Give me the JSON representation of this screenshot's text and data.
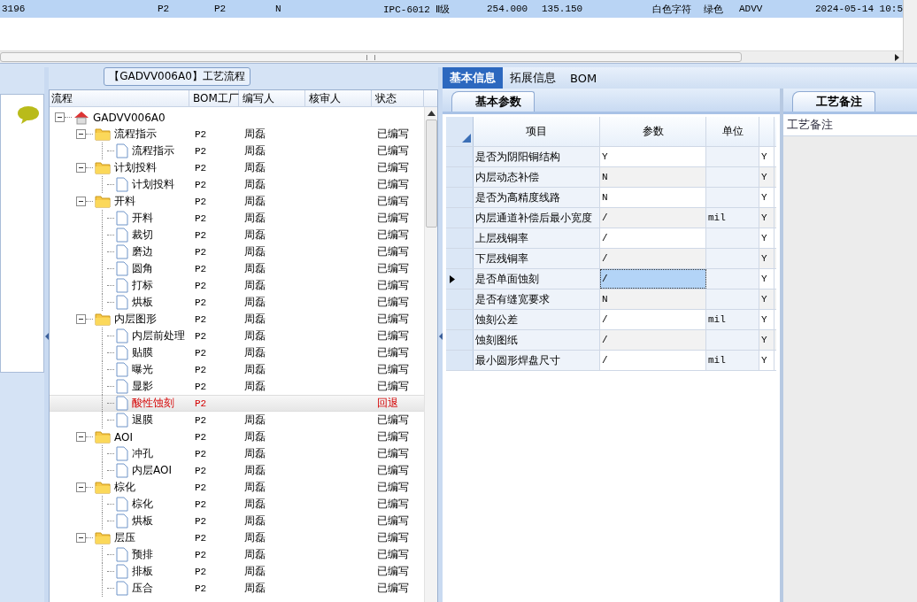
{
  "top_grid": {
    "rows": [
      {
        "selected": true,
        "cells": [
          "3196",
          "P2",
          "P2",
          "N",
          "IPC-6012 Ⅱ级",
          "254.000",
          "135.150",
          "白色字符",
          "绿色",
          "ADVV",
          "2024-05-14 10:5"
        ]
      }
    ]
  },
  "tree": {
    "title": "【GADVV006A0】工艺流程",
    "columns": [
      "流程",
      "BOM工厂",
      "编写人",
      "核审人",
      "状态"
    ],
    "nodes": [
      {
        "label": "GADVV006A0",
        "kind": "root",
        "expanded": true,
        "selected": false,
        "returned": false,
        "children": [
          {
            "label": "流程指示",
            "kind": "folder",
            "factory": "P2",
            "author": "周磊",
            "status": "已编写",
            "expanded": true,
            "selected": false,
            "returned": false,
            "children": [
              {
                "label": "流程指示",
                "kind": "doc",
                "factory": "P2",
                "author": "周磊",
                "status": "已编写",
                "selected": false,
                "returned": false
              }
            ]
          },
          {
            "label": "计划投料",
            "kind": "folder",
            "factory": "P2",
            "author": "周磊",
            "status": "已编写",
            "expanded": true,
            "selected": false,
            "returned": false,
            "children": [
              {
                "label": "计划投料",
                "kind": "doc",
                "factory": "P2",
                "author": "周磊",
                "status": "已编写",
                "selected": false,
                "returned": false
              }
            ]
          },
          {
            "label": "开料",
            "kind": "folder",
            "factory": "P2",
            "author": "周磊",
            "status": "已编写",
            "expanded": true,
            "selected": false,
            "returned": false,
            "children": [
              {
                "label": "开料",
                "kind": "doc",
                "factory": "P2",
                "author": "周磊",
                "status": "已编写",
                "selected": false,
                "returned": false
              },
              {
                "label": "裁切",
                "kind": "doc",
                "factory": "P2",
                "author": "周磊",
                "status": "已编写",
                "selected": false,
                "returned": false
              },
              {
                "label": "磨边",
                "kind": "doc",
                "factory": "P2",
                "author": "周磊",
                "status": "已编写",
                "selected": false,
                "returned": false
              },
              {
                "label": "圆角",
                "kind": "doc",
                "factory": "P2",
                "author": "周磊",
                "status": "已编写",
                "selected": false,
                "returned": false
              },
              {
                "label": "打标",
                "kind": "doc",
                "factory": "P2",
                "author": "周磊",
                "status": "已编写",
                "selected": false,
                "returned": false
              },
              {
                "label": "烘板",
                "kind": "doc",
                "factory": "P2",
                "author": "周磊",
                "status": "已编写",
                "selected": false,
                "returned": false
              }
            ]
          },
          {
            "label": "内层图形",
            "kind": "folder",
            "factory": "P2",
            "author": "周磊",
            "status": "已编写",
            "expanded": true,
            "selected": false,
            "returned": false,
            "children": [
              {
                "label": "内层前处理",
                "kind": "doc",
                "factory": "P2",
                "author": "周磊",
                "status": "已编写",
                "selected": false,
                "returned": false
              },
              {
                "label": "贴膜",
                "kind": "doc",
                "factory": "P2",
                "author": "周磊",
                "status": "已编写",
                "selected": false,
                "returned": false
              },
              {
                "label": "曝光",
                "kind": "doc",
                "factory": "P2",
                "author": "周磊",
                "status": "已编写",
                "selected": false,
                "returned": false
              },
              {
                "label": "显影",
                "kind": "doc",
                "factory": "P2",
                "author": "周磊",
                "status": "已编写",
                "selected": false,
                "returned": false
              },
              {
                "label": "酸性蚀刻",
                "kind": "doc",
                "factory": "P2",
                "status": "回退",
                "selected": true,
                "returned": true
              },
              {
                "label": "退膜",
                "kind": "doc",
                "factory": "P2",
                "author": "周磊",
                "status": "已编写",
                "selected": false,
                "returned": false
              }
            ]
          },
          {
            "label": "AOI",
            "kind": "folder",
            "factory": "P2",
            "author": "周磊",
            "status": "已编写",
            "expanded": true,
            "selected": false,
            "returned": false,
            "children": [
              {
                "label": "冲孔",
                "kind": "doc",
                "factory": "P2",
                "author": "周磊",
                "status": "已编写",
                "selected": false,
                "returned": false
              },
              {
                "label": "内层AOI",
                "kind": "doc",
                "factory": "P2",
                "author": "周磊",
                "status": "已编写",
                "selected": false,
                "returned": false
              }
            ]
          },
          {
            "label": "棕化",
            "kind": "folder",
            "factory": "P2",
            "author": "周磊",
            "status": "已编写",
            "expanded": true,
            "selected": false,
            "returned": false,
            "children": [
              {
                "label": "棕化",
                "kind": "doc",
                "factory": "P2",
                "author": "周磊",
                "status": "已编写",
                "selected": false,
                "returned": false
              },
              {
                "label": "烘板",
                "kind": "doc",
                "factory": "P2",
                "author": "周磊",
                "status": "已编写",
                "selected": false,
                "returned": false
              }
            ]
          },
          {
            "label": "层压",
            "kind": "folder",
            "factory": "P2",
            "author": "周磊",
            "status": "已编写",
            "expanded": true,
            "selected": false,
            "returned": false,
            "children": [
              {
                "label": "预排",
                "kind": "doc",
                "factory": "P2",
                "author": "周磊",
                "status": "已编写",
                "selected": false,
                "returned": false
              },
              {
                "label": "排板",
                "kind": "doc",
                "factory": "P2",
                "author": "周磊",
                "status": "已编写",
                "selected": false,
                "returned": false
              },
              {
                "label": "压合",
                "kind": "doc",
                "factory": "P2",
                "author": "周磊",
                "status": "已编写",
                "selected": false,
                "returned": false
              }
            ]
          }
        ]
      }
    ]
  },
  "detail": {
    "tabs": [
      {
        "label": "基本信息",
        "selected": true
      },
      {
        "label": "拓展信息",
        "selected": false
      },
      {
        "label": "BOM",
        "selected": false
      }
    ],
    "params": {
      "tab": "基本参数",
      "columns": [
        "项目",
        "参数",
        "单位"
      ],
      "rows": [
        {
          "item": "是否为阴阳铜结构",
          "value": "Y",
          "flag": "Y",
          "selected": false
        },
        {
          "item": "内层动态补偿",
          "value": "N",
          "flag": "Y",
          "selected": false
        },
        {
          "item": "是否为高精度线路",
          "value": "N",
          "flag": "Y",
          "selected": false
        },
        {
          "item": "内层通道补偿后最小宽度",
          "value": "/",
          "unit": "mil",
          "flag": "Y",
          "selected": false
        },
        {
          "item": "上层残铜率",
          "value": "/",
          "flag": "Y",
          "selected": false
        },
        {
          "item": "下层残铜率",
          "value": "/",
          "flag": "Y",
          "selected": false
        },
        {
          "item": "是否单面蚀刻",
          "value": "/",
          "flag": "Y",
          "selected": true
        },
        {
          "item": "是否有缝宽要求",
          "value": "N",
          "flag": "Y",
          "selected": false
        },
        {
          "item": "蚀刻公差",
          "value": "/",
          "unit": "mil",
          "flag": "Y",
          "selected": false
        },
        {
          "item": "蚀刻图纸",
          "value": "/",
          "flag": "Y",
          "selected": false
        },
        {
          "item": "最小圆形焊盘尺寸",
          "value": "/",
          "unit": "mil",
          "flag": "Y",
          "selected": false
        }
      ]
    },
    "notes": {
      "tab": "工艺备注",
      "label": "工艺备注"
    }
  }
}
